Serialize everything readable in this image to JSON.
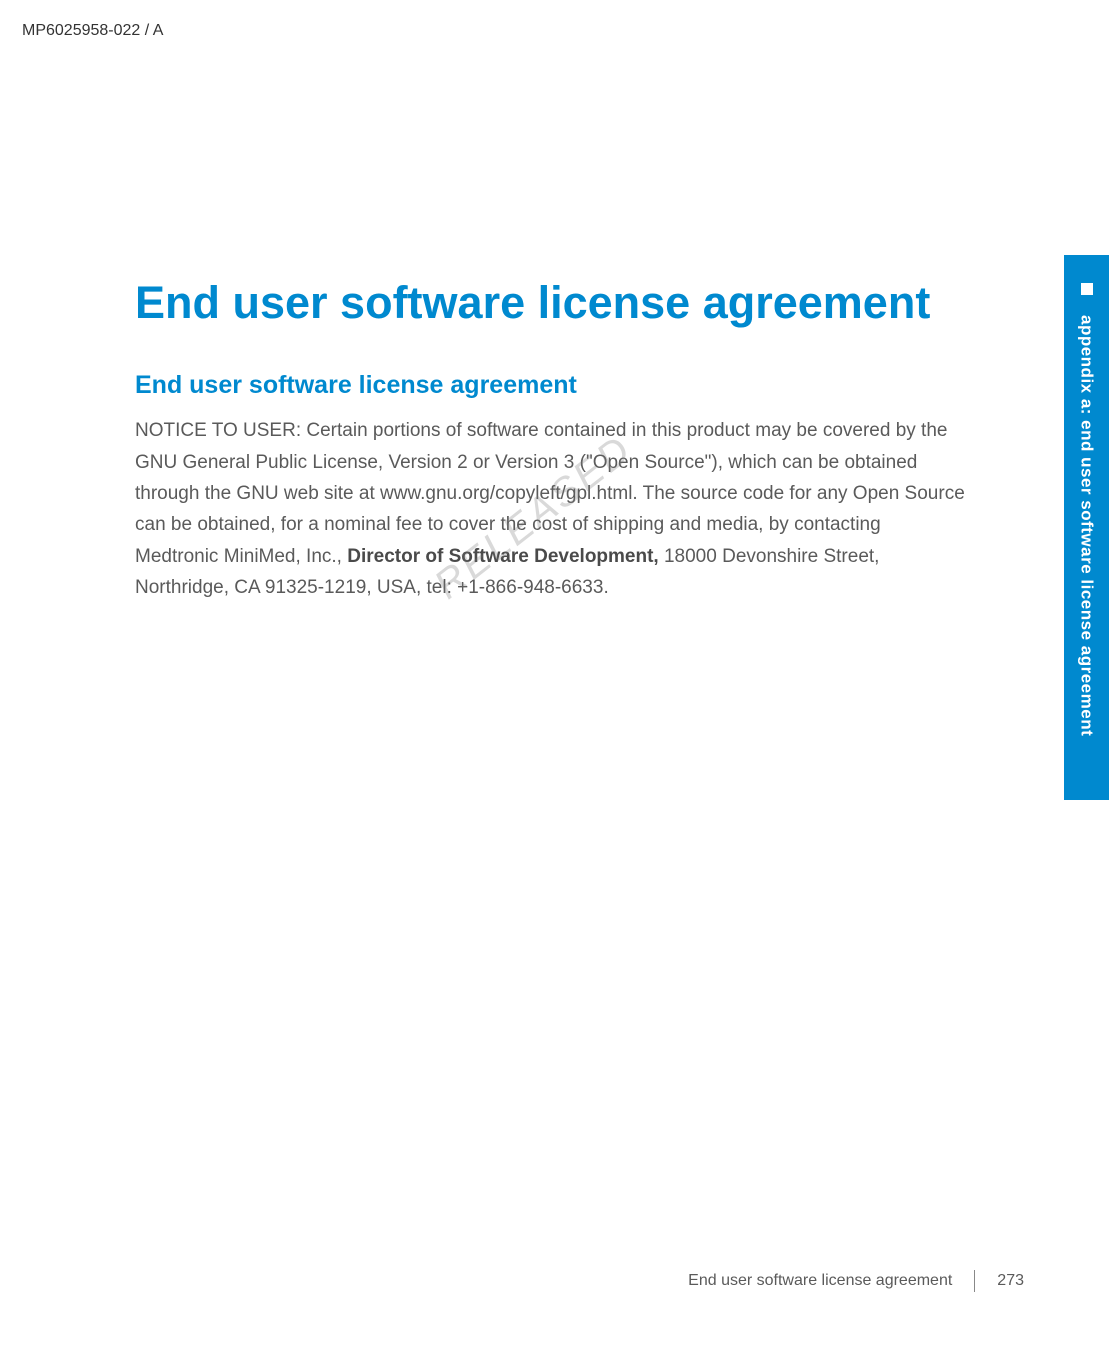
{
  "header": {
    "doc_code": "MP6025958-022 / A"
  },
  "side_tab": {
    "label": "appendix a: end user software license agreement"
  },
  "content": {
    "main_title": "End user software license agreement",
    "section_title": "End user software license agreement",
    "paragraph_part1": "NOTICE TO USER: Certain portions of software contained in this product may be covered by the GNU General Public License, Version 2 or Version 3 (\"Open Source\"), which can be obtained through the GNU web site at www.gnu.org/copyleft/gpl.html. The source code for any Open Source can be obtained, for a nominal fee to cover the cost of shipping and media, by contacting Medtronic MiniMed, Inc., ",
    "paragraph_bold": "Director of Software Development,",
    "paragraph_part2": " 18000 Devonshire Street, Northridge, CA 91325-1219, USA, tel: +1-866-948-6633."
  },
  "watermark": {
    "text": "RELEASED"
  },
  "footer": {
    "title": "End user software license agreement",
    "page": "273"
  }
}
